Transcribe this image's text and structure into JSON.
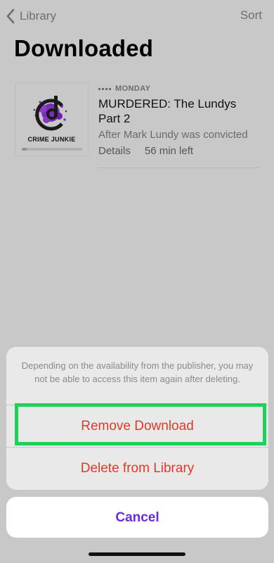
{
  "nav": {
    "back_label": "Library",
    "sort_label": "Sort"
  },
  "page": {
    "title": "Downloaded"
  },
  "episode": {
    "artwork_title": "CRIME JUNKIE",
    "artwork_progress": 0.08,
    "day": "MONDAY",
    "title": "MURDERED: The Lundys Part 2",
    "description": "After Mark Lundy was convicted",
    "details_label": "Details",
    "time_left": "56 min left"
  },
  "action_sheet": {
    "message": "Depending on the availability from the publisher, you may not be able to access this item again after deleting.",
    "remove_label": "Remove Download",
    "delete_label": "Delete from Library",
    "cancel_label": "Cancel"
  },
  "colors": {
    "destructive": "#e0392b",
    "accent": "#6e2bd8",
    "highlight": "#1fd05a"
  },
  "icons": {
    "back": "chevron-left-icon",
    "menu": "dots-icon"
  }
}
